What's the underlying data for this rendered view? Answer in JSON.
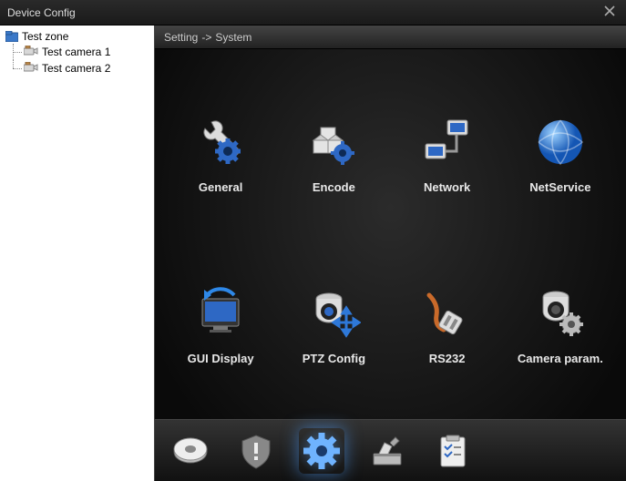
{
  "window": {
    "title": "Device Config"
  },
  "tree": {
    "root_label": "Test zone",
    "items": [
      {
        "label": "Test camera 1"
      },
      {
        "label": "Test camera 2"
      }
    ]
  },
  "breadcrumb": {
    "path1": "Setting",
    "sep": "->",
    "path2": "System"
  },
  "grid": {
    "items": [
      {
        "label": "General",
        "icon": "wrench-gear"
      },
      {
        "label": "Encode",
        "icon": "blocks-gear"
      },
      {
        "label": "Network",
        "icon": "network"
      },
      {
        "label": "NetService",
        "icon": "globe"
      },
      {
        "label": "GUI Display",
        "icon": "monitor-refresh"
      },
      {
        "label": "PTZ Config",
        "icon": "camera-arrows"
      },
      {
        "label": "RS232",
        "icon": "serial-plug"
      },
      {
        "label": "Camera param.",
        "icon": "camera-gear"
      }
    ]
  },
  "bottom": {
    "items": [
      {
        "name": "recording-tab",
        "icon": "disk"
      },
      {
        "name": "alarm-tab",
        "icon": "shield-alert"
      },
      {
        "name": "system-tab",
        "icon": "gear-cog",
        "active": true
      },
      {
        "name": "tools-tab",
        "icon": "tools"
      },
      {
        "name": "info-tab",
        "icon": "checklist"
      }
    ]
  }
}
